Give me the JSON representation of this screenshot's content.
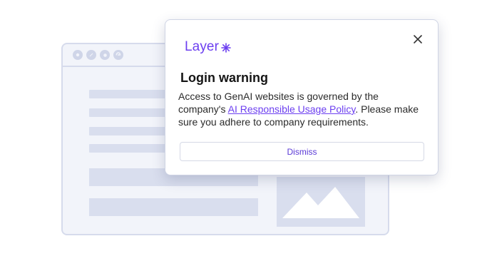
{
  "brand": {
    "logo_text": "Layer",
    "logo_icon": "sparkle-icon",
    "accent_color": "#6c3ff0"
  },
  "modal": {
    "title": "Login warning",
    "body_before_link": "Access to GenAI websites is governed by the company's ",
    "link_text": "AI Responsible Usage Policy",
    "body_after_link": ". Please make sure you adhere to company requirements.",
    "dismiss_label": "Dismiss",
    "close_icon": "close-icon"
  },
  "background_browser": {
    "toolbar_icons": [
      "chrome-icon",
      "safari-icon",
      "firefox-icon",
      "edge-icon"
    ]
  }
}
